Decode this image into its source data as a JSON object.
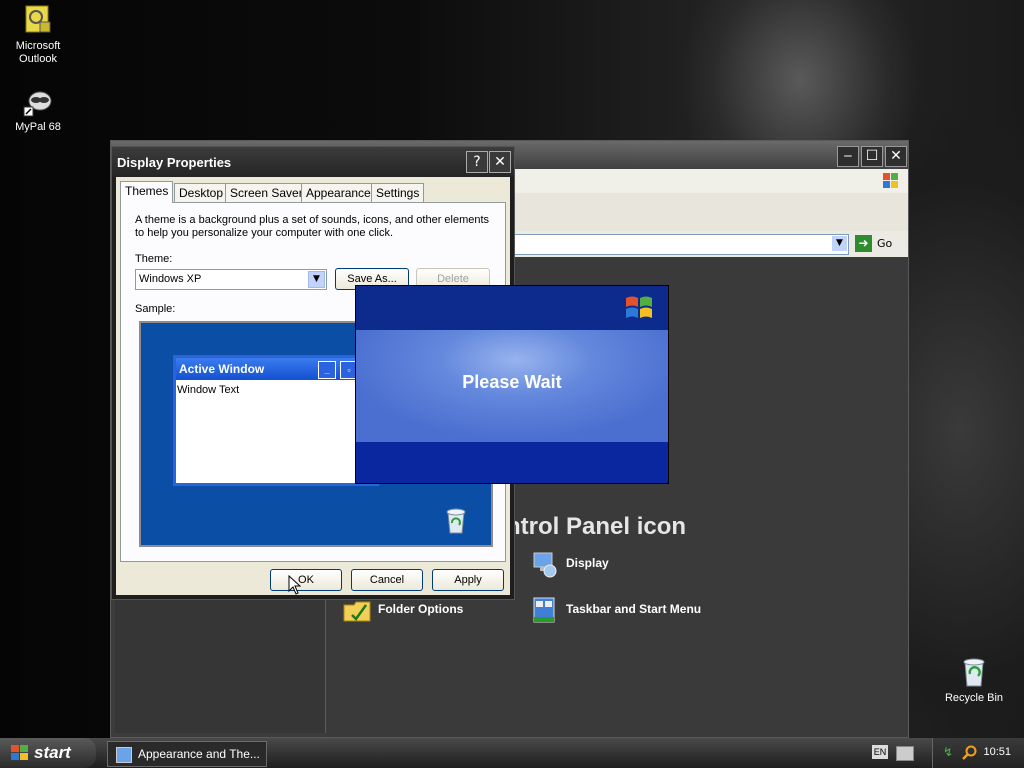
{
  "desktop": {
    "icons": [
      {
        "label": "Microsoft\nOutlook",
        "line1": "Microsoft",
        "line2": "Outlook"
      },
      {
        "label": "MyPal 68"
      },
      {
        "label": "Recycle Bin"
      }
    ]
  },
  "control_panel": {
    "heading": "ntrol Panel icon",
    "go_label": "Go",
    "links": [
      {
        "label": "Display",
        "icon": "display-icon"
      },
      {
        "label": "Folder Options",
        "icon": "folder-options-icon"
      },
      {
        "label": "Taskbar and Start Menu",
        "icon": "taskbar-start-menu-icon"
      }
    ]
  },
  "display_properties": {
    "title": "Display Properties",
    "tabs": [
      "Themes",
      "Desktop",
      "Screen Saver",
      "Appearance",
      "Settings"
    ],
    "description": "A theme is a background plus a set of sounds, icons, and other elements to help you personalize your computer with one click.",
    "theme_label": "Theme:",
    "theme_value": "Windows XP",
    "save_as": "Save As...",
    "delete": "Delete",
    "sample_label": "Sample:",
    "sample_window_title": "Active Window",
    "sample_window_text": "Window Text",
    "ok": "OK",
    "cancel": "Cancel",
    "apply": "Apply"
  },
  "wait_dialog": {
    "message": "Please Wait"
  },
  "taskbar": {
    "start_label": "start",
    "task_item": "Appearance and The...",
    "language": "EN",
    "clock": "10:51"
  },
  "colors": {
    "xp_blue": "#0b4ea6",
    "dialog_face": "#ece9d8",
    "splash_blue": "#0c2a8a"
  }
}
